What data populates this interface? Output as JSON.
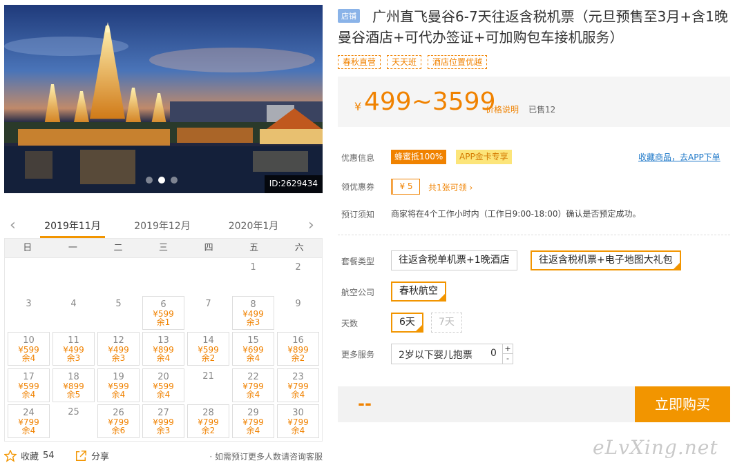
{
  "gallery": {
    "photo_id": "ID:2629434",
    "slide_count": 3,
    "active_slide": 2
  },
  "calendar": {
    "prev_icon": "chevron-left",
    "next_icon": "chevron-right",
    "months": [
      "2019年11月",
      "2019年12月",
      "2020年1月"
    ],
    "active_month": 0,
    "weekdays": [
      "日",
      "一",
      "二",
      "三",
      "四",
      "五",
      "六"
    ],
    "first_weekday": 5,
    "days": [
      {
        "d": "1"
      },
      {
        "d": "2"
      },
      {
        "d": "3"
      },
      {
        "d": "4"
      },
      {
        "d": "5"
      },
      {
        "d": "6",
        "price": "¥599",
        "stock": "余1"
      },
      {
        "d": "7"
      },
      {
        "d": "8",
        "price": "¥499",
        "stock": "余3"
      },
      {
        "d": "9"
      },
      {
        "d": "10",
        "price": "¥599",
        "stock": "余4"
      },
      {
        "d": "11",
        "price": "¥499",
        "stock": "余3"
      },
      {
        "d": "12",
        "price": "¥499",
        "stock": "余3"
      },
      {
        "d": "13",
        "price": "¥899",
        "stock": "余4"
      },
      {
        "d": "14",
        "price": "¥599",
        "stock": "余2"
      },
      {
        "d": "15",
        "price": "¥699",
        "stock": "余4"
      },
      {
        "d": "16",
        "price": "¥899",
        "stock": "余2"
      },
      {
        "d": "17",
        "price": "¥599",
        "stock": "余4"
      },
      {
        "d": "18",
        "price": "¥899",
        "stock": "余5"
      },
      {
        "d": "19",
        "price": "¥599",
        "stock": "余4"
      },
      {
        "d": "20",
        "price": "¥599",
        "stock": "余4"
      },
      {
        "d": "21"
      },
      {
        "d": "22",
        "price": "¥799",
        "stock": "余4"
      },
      {
        "d": "23",
        "price": "¥799",
        "stock": "余4"
      },
      {
        "d": "24",
        "price": "¥799",
        "stock": "余4"
      },
      {
        "d": "25"
      },
      {
        "d": "26",
        "price": "¥799",
        "stock": "余6"
      },
      {
        "d": "27",
        "price": "¥999",
        "stock": "余3"
      },
      {
        "d": "28",
        "price": "¥799",
        "stock": "余2"
      },
      {
        "d": "29",
        "price": "¥799",
        "stock": "余4"
      },
      {
        "d": "30",
        "price": "¥799",
        "stock": "余4"
      }
    ]
  },
  "actions": {
    "favorite_label": "收藏",
    "favorite_count": "54",
    "share_label": "分享",
    "contact_note": "· 如需预订更多人数请咨询客服"
  },
  "product": {
    "shop_tag": "店铺",
    "title": "广州直飞曼谷6-7天往返含税机票（元旦预售至3月+含1晚曼谷酒店+可代办签证+可加购包车接机服务）",
    "tags": [
      "春秋直营",
      "天天班",
      "酒店位置优越"
    ],
    "price_symbol": "¥",
    "price_range": "499~3599",
    "price_explain": "价格说明",
    "sold": "已售12"
  },
  "promotions": {
    "label": "优惠信息",
    "tag_a": "蜂蜜抵100%",
    "tag_b": "APP金卡专享",
    "app_link": "收藏商品，去APP下单"
  },
  "coupon": {
    "label": "领优惠券",
    "value": "¥ 5",
    "more": "共1张可领 ›"
  },
  "booking_notice": {
    "label": "预订须知",
    "text": "商家将在4个工作小时内（工作日9:00-18:00）确认是否预定成功。"
  },
  "options": {
    "package_label": "套餐类型",
    "packages": [
      "往返含税单机票+1晚酒店",
      "往返含税机票+电子地图大礼包"
    ],
    "airline_label": "航空公司",
    "airline": "春秋航空",
    "days_label": "天数",
    "days": [
      "6天",
      "7天"
    ],
    "services_label": "更多服务",
    "service_name": "2岁以下婴儿抱票",
    "service_qty": "0",
    "plus": "+",
    "minus": "-"
  },
  "purchase": {
    "total": "--",
    "buy_label": "立即购买"
  },
  "watermark": "eLvXing.net",
  "colors": {
    "accent": "#f29500",
    "price": "#f08200",
    "link": "#1e78c8"
  }
}
